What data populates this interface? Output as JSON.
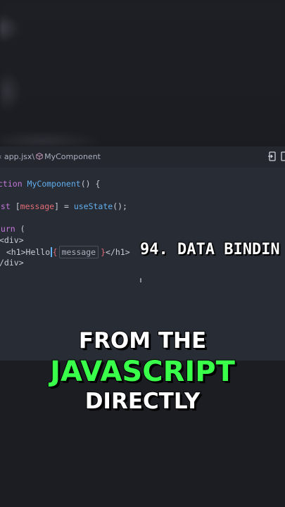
{
  "editor": {
    "breadcrumb": {
      "file": "app.jsx\\",
      "symbol": "MyComponent"
    },
    "code_lines": [
      {
        "tokens": [
          {
            "t": "ction ",
            "c": "kw"
          },
          {
            "t": "MyComponent",
            "c": "fn"
          },
          {
            "t": "() {",
            "c": "plain"
          }
        ]
      },
      {
        "tokens": [
          {
            "t": "nst ",
            "c": "kw"
          },
          {
            "t": "[",
            "c": "plain"
          },
          {
            "t": "message",
            "c": "var"
          },
          {
            "t": "] = ",
            "c": "plain"
          },
          {
            "t": "useState",
            "c": "fn"
          },
          {
            "t": "();",
            "c": "plain"
          }
        ]
      },
      {
        "tokens": [
          {
            "t": "turn ",
            "c": "kw"
          },
          {
            "t": "(",
            "c": "plain"
          }
        ]
      },
      {
        "tokens": [
          {
            "t": "<div>",
            "c": "plain"
          }
        ]
      },
      {
        "tokens": [
          {
            "t": "  <h1>Hello",
            "c": "plain"
          }
        ]
      },
      {
        "tokens": [
          {
            "t": "/div>",
            "c": "plain"
          }
        ]
      }
    ],
    "interpolation": {
      "open": "{",
      "name": "message",
      "close": "}",
      "tail": "</h1>"
    }
  },
  "overlay": {
    "title": "94. DATA BINDIN"
  },
  "captions": {
    "line1": "FROM THE",
    "line2": "JAVASCRIPT",
    "line3": "DIRECTLY"
  },
  "colors": {
    "keyword": "#c678dd",
    "function": "#61afef",
    "variable": "#e06c75",
    "highlight_green": "#39ff4a"
  }
}
